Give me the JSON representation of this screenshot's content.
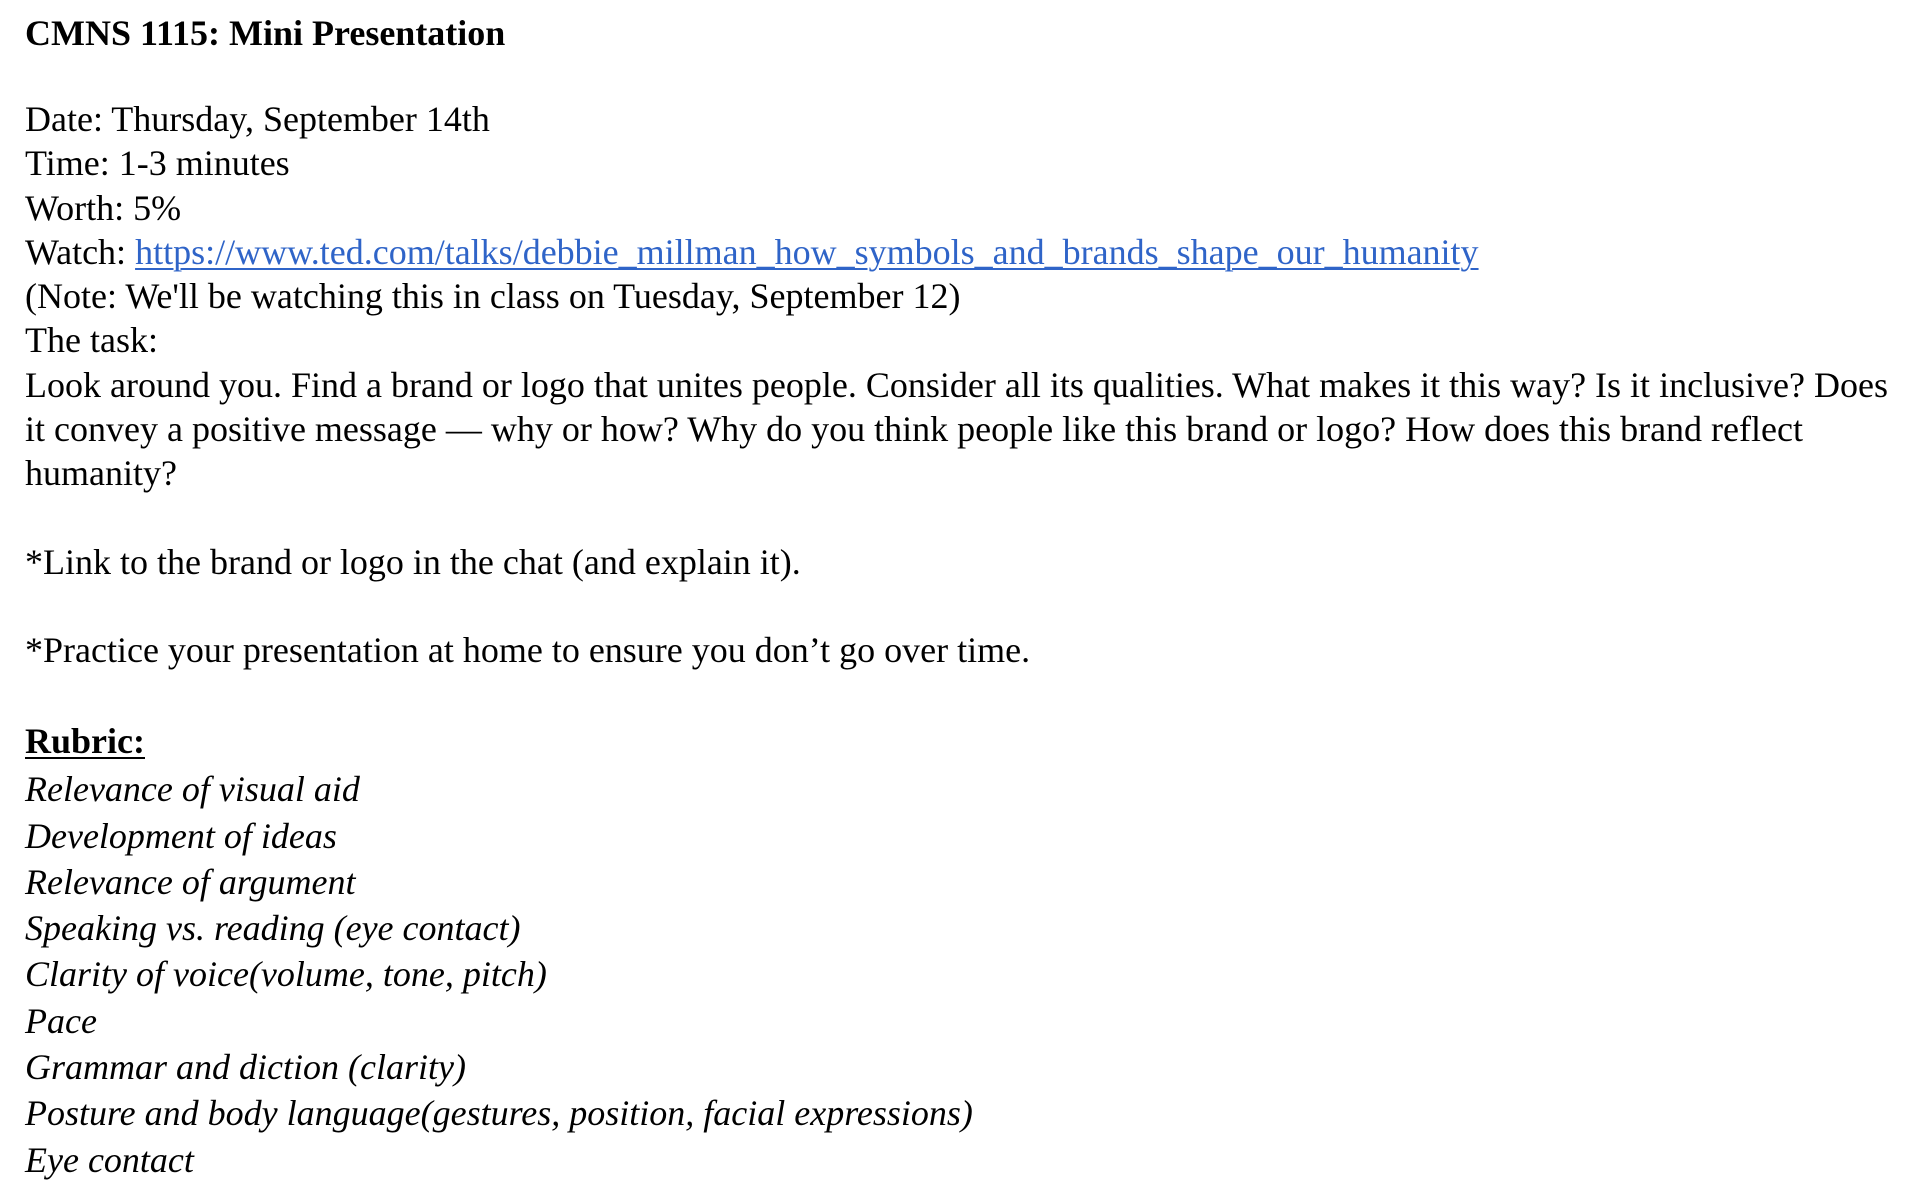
{
  "document": {
    "title": "CMNS 1115: Mini Presentation",
    "date_line": "Date: Thursday, September 14th",
    "time_line": "Time: 1-3 minutes",
    "worth_line": "Worth: 5%",
    "watch_label": "Watch: ",
    "watch_url": "https://www.ted.com/talks/debbie_millman_how_symbols_and_brands_shape_our_humanity",
    "note_line": "(Note: We'll be watching this in class on Tuesday, September 12)",
    "task_label": "The task:",
    "task_body": "Look around you. Find a brand or logo that unites people. Consider all its qualities. What makes it this way? Is it inclusive? Does it convey a positive message — why or how? Why do you think people like this brand or logo? How does this brand reflect humanity?",
    "instruction_1": "*Link to the brand or logo in the chat (and explain it).",
    "instruction_2": "*Practice your presentation at home to ensure you don’t go over time.",
    "rubric_heading": "Rubric:",
    "rubric_items": [
      "Relevance of visual aid",
      "Development of ideas",
      "Relevance of argument",
      "Speaking vs. reading (eye contact)",
      "Clarity of voice(volume, tone, pitch)",
      "Pace",
      "Grammar and diction (clarity)",
      "Posture and body language(gestures, position, facial expressions)",
      "Eye contact"
    ]
  },
  "colors": {
    "text": "#000000",
    "link": "#2f64c8",
    "background": "#ffffff"
  }
}
